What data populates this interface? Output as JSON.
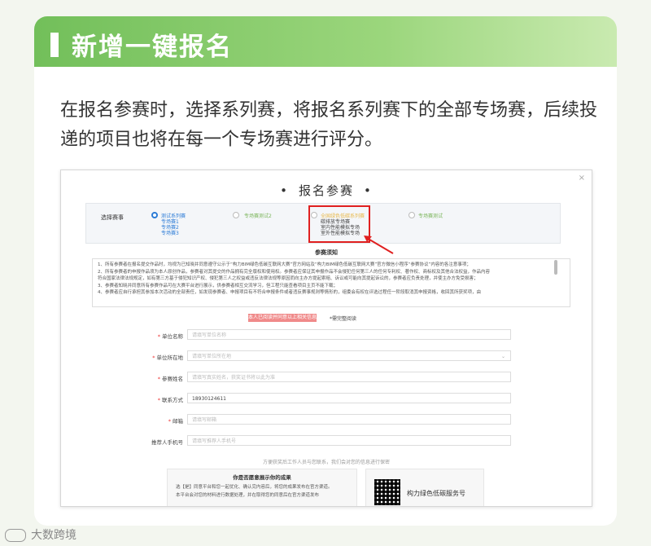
{
  "section": {
    "title": "新增一键报名"
  },
  "description": "在报名参赛时，选择系列赛，将报名系列赛下的全部专场赛，后续投递的项目也将在每一个专场赛进行评分。",
  "form": {
    "close": "×",
    "title": "报名参赛",
    "series_label": "选择赛事",
    "options": [
      {
        "label": "测试系列赛",
        "selected": true,
        "subs": [
          "专场赛1",
          "专场赛2",
          "专场赛3"
        ]
      },
      {
        "label": "专场赛测试2",
        "selected": false
      },
      {
        "label": "全国绿色低碳系列赛",
        "selected": false,
        "subs": [
          "碳排放专场赛",
          "室内性能模拟专场",
          "室外性能模拟专场"
        ]
      },
      {
        "label": "专场赛测试",
        "selected": false
      }
    ],
    "notice_title": "参赛须知",
    "notice_lines": [
      "1、所有参赛者在报名提交作品时，均视为已知晓并同意遵守公示于“构力BIM绿色低碳互联网大赛”官方网站及“构力BIM绿色低碳互联网大赛”官方微信小程序“参赛协议”内容的各注意事项；",
      "2、所有参赛者的申报作品须为本人原创作品，参赛者对其提交的作品拥有完全版权和使用权。参赛者应保证其申报作品不会侵犯任何第三人的任何专利权、著作权、商标权及其他合法权益，作品内容",
      "符合国家法律法规规定，如有第三方基于侵犯知识产权、侵犯第三人之权益或违反法律法规等原因而向主办方提起索赔、诉讼或可能向其提起诉讼的，参赛者应负责处理，并使主办方免受损害；",
      "3、参赛者知晓并同意所有参赛作品可在大赛平台进行展示，供参赛者相互交流学习，但工程只能查看项目主页不能下载；",
      "4、参赛者应自行承担其参加本次活动的全部责任，如发现参赛者、申报项目有不符合申报条件或者违反赛事规则等情形的，组委会有权在评选过程任一阶段取消其申报资格，收回其所获奖项，由"
    ],
    "agree_button": "本人已阅读并同意以上相关信息",
    "agree_link": "*需完整阅读",
    "fields": [
      {
        "label": "单位名称",
        "required": true,
        "placeholder": "请填写单位名称",
        "value": ""
      },
      {
        "label": "单位所在地",
        "required": true,
        "placeholder": "请填写单位所在地",
        "value": "",
        "dropdown": true
      },
      {
        "label": "参赛姓名",
        "required": true,
        "placeholder": "请填写真实姓名，获奖证书将以此为准",
        "value": ""
      },
      {
        "label": "联系方式",
        "required": true,
        "placeholder": "",
        "value": "18930124611"
      },
      {
        "label": "邮箱",
        "required": true,
        "placeholder": "请填写邮箱",
        "value": ""
      },
      {
        "label": "推荐人手机号",
        "required": false,
        "placeholder": "请填写推荐人手机号",
        "value": ""
      }
    ],
    "tip": "方便获奖后工作人员与您联系，我们会对您的信息进行保密",
    "promo": {
      "title": "你是否愿意展示你的成果",
      "line1": "选【是】同意平台和您一起优化、确认完内容后，将您的成果发布在官方渠道。",
      "line2": "本平台会对您的材料进行数据处理，并在取得您的同意后在官方渠道发布"
    },
    "service_name": "构力绿色低碳服务号"
  },
  "watermark": "大数跨境",
  "colors": {
    "accent": "#72bf5a",
    "highlight": "#e02020",
    "link": "#2b7bd6"
  }
}
